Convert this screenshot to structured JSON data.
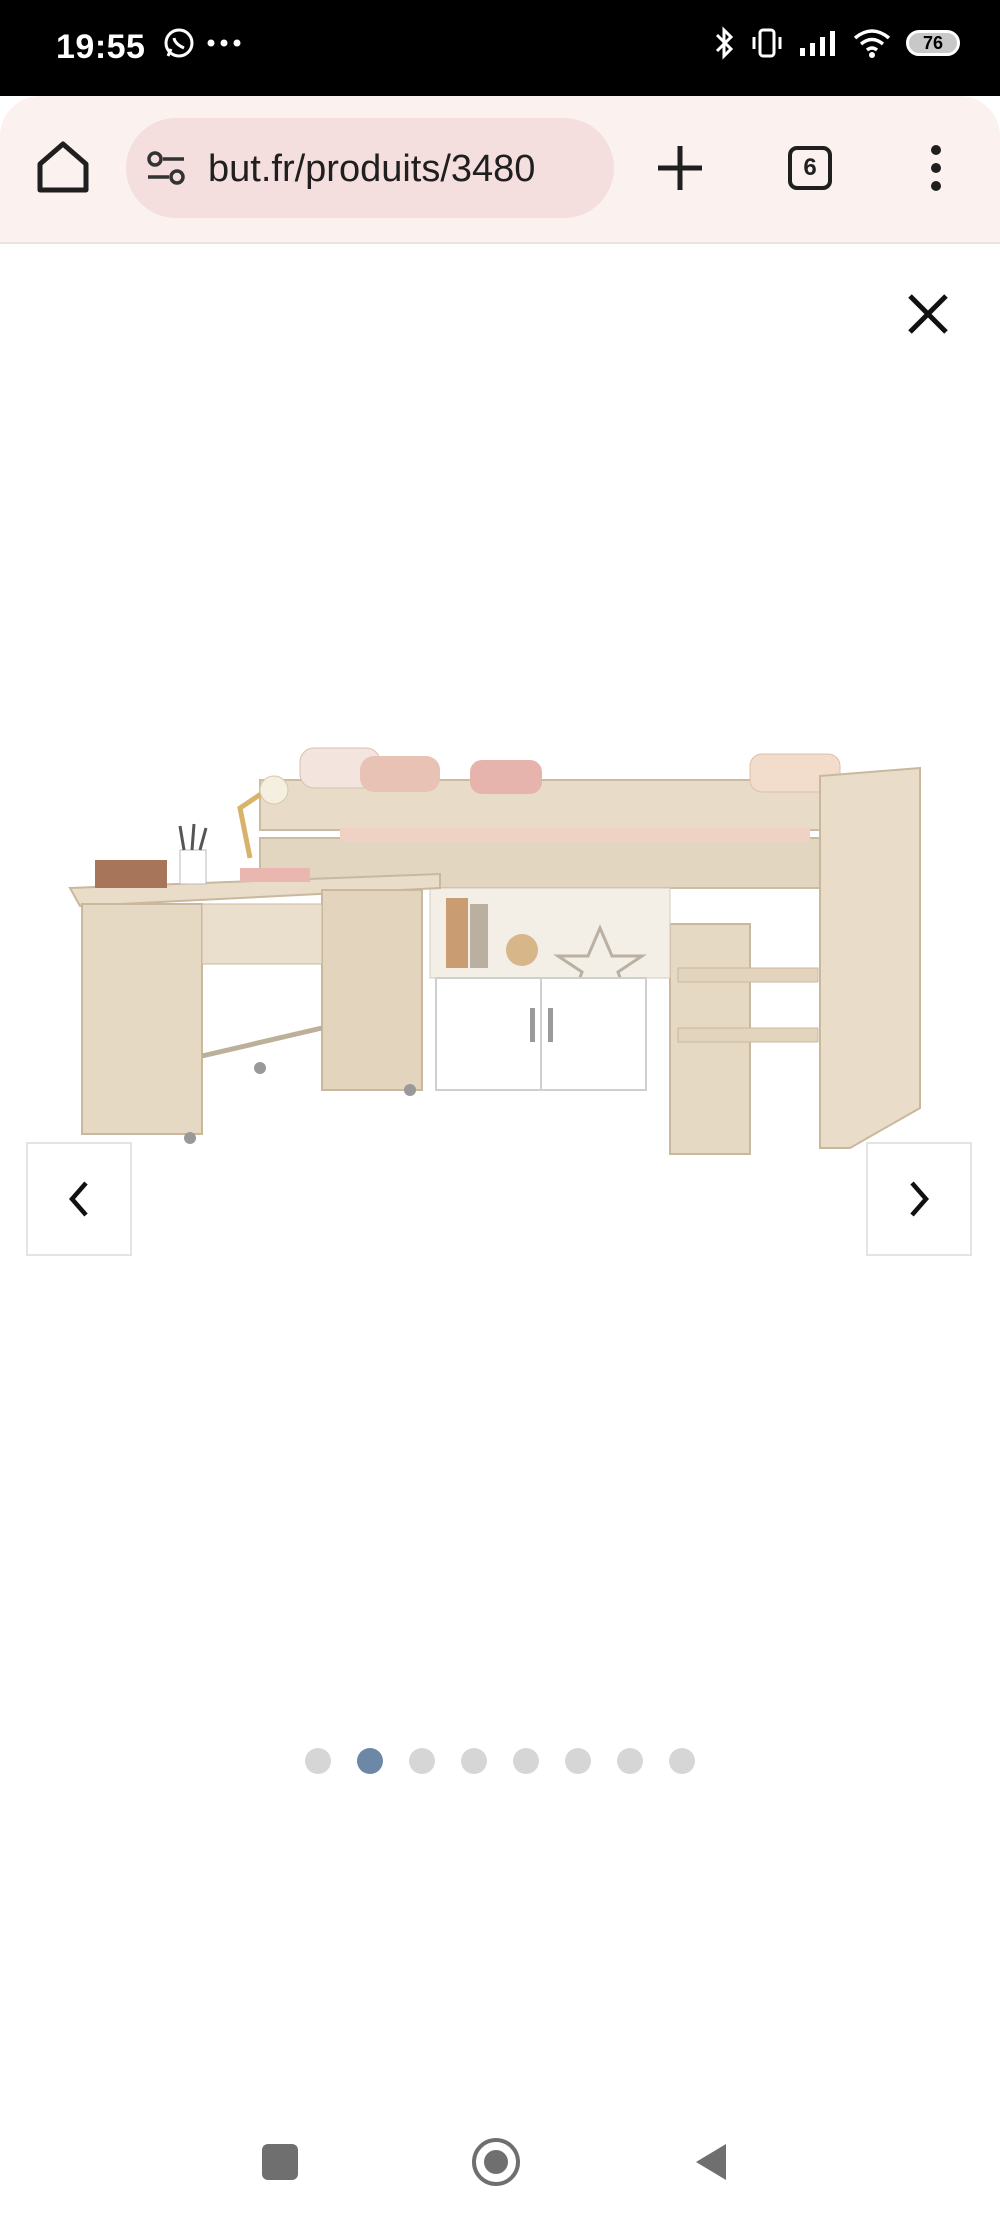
{
  "status_bar": {
    "time": "19:55",
    "notification_icons": [
      "whatsapp-icon",
      "more-notifications-icon"
    ],
    "system_icons": [
      "bluetooth-icon",
      "vibrate-icon",
      "signal-icon",
      "wifi-icon"
    ],
    "battery": "76"
  },
  "browser": {
    "url": "but.fr/produits/3480",
    "tab_count": "6"
  },
  "gallery": {
    "image_count": 8,
    "active_index": 1,
    "image_subject": "combined mid-sleeper bed with desk, cabinet and shelves"
  },
  "colors": {
    "toolbar_bg": "#fbf2ef",
    "urlbar_bg": "#f4dede",
    "dot_active": "#6d87a6",
    "dot_inactive": "#d6d6d6"
  }
}
